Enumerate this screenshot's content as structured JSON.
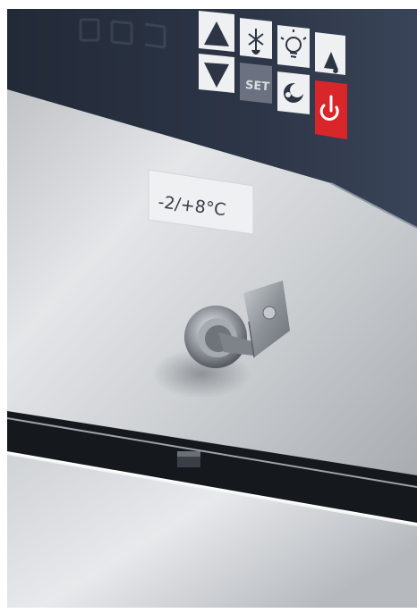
{
  "temperature_label": "-2/+8°C",
  "keypad": {
    "set_label": "SET",
    "buttons": [
      {
        "name": "up-button",
        "icon": "triangle-up-icon"
      },
      {
        "name": "defrost-button",
        "icon": "defrost-icon"
      },
      {
        "name": "light-button",
        "icon": "light-bulb-icon"
      },
      {
        "name": "humidity-button",
        "icon": "humidity-drops-icon"
      },
      {
        "name": "down-button",
        "icon": "triangle-down-icon"
      },
      {
        "name": "set-button",
        "icon": "set-icon"
      },
      {
        "name": "standby-button",
        "icon": "eco-moon-icon"
      },
      {
        "name": "power-button",
        "icon": "power-icon"
      }
    ]
  },
  "colors": {
    "panel": "#2a3242",
    "steel": "#c9ccd0",
    "power": "#d9262b",
    "button": "#e9ecef"
  }
}
